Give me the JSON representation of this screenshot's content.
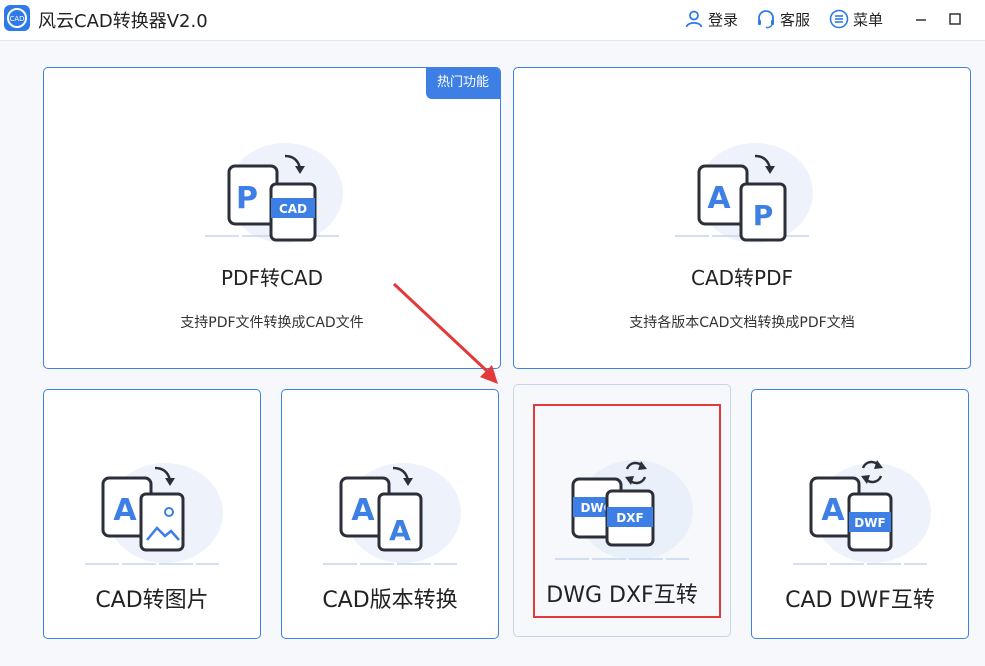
{
  "window": {
    "title": "风云CAD转换器V2.0",
    "logo_icon": "cad-logo-icon",
    "actions": [
      {
        "label": "登录",
        "icon": "user-icon"
      },
      {
        "label": "客服",
        "icon": "headset-icon"
      },
      {
        "label": "菜单",
        "icon": "menu-icon"
      }
    ]
  },
  "cards": {
    "pdf_to_cad": {
      "title": "PDF转CAD",
      "desc": "支持PDF文件转换成CAD文件",
      "badge": "热门功能",
      "doc_letter": "P",
      "target_label": "CAD"
    },
    "cad_to_pdf": {
      "title": "CAD转PDF",
      "desc": "支持各版本CAD文档转换成PDF文档",
      "doc_letter": "A",
      "target_letter": "P"
    },
    "cad_to_image": {
      "title": "CAD转图片",
      "doc_letter": "A"
    },
    "cad_version": {
      "title": "CAD版本转换",
      "doc_letter": "A",
      "target_letter": "A"
    },
    "dwg_dxf": {
      "title": "DWG DXF互转",
      "source_label": "DWG",
      "target_label": "DXF"
    },
    "cad_dwf": {
      "title": "CAD DWF互转",
      "doc_letter": "A",
      "target_label": "DWF"
    }
  },
  "colors": {
    "accent": "#3d7fe4",
    "highlight": "#e23a3a",
    "icon_dark": "#2b2f3a"
  }
}
